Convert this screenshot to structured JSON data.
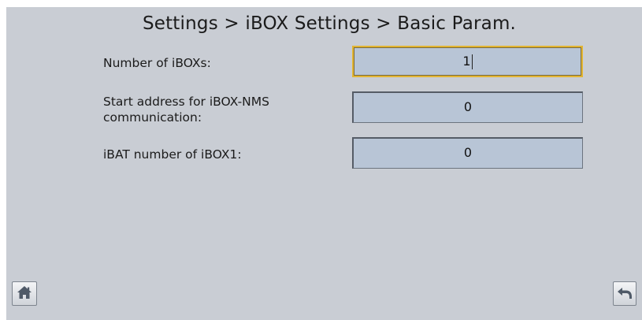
{
  "header": {
    "breadcrumb": "Settings > iBOX Settings > Basic Param."
  },
  "form": {
    "rows": [
      {
        "label": "Number of iBOXs:",
        "value": "1"
      },
      {
        "label": "Start address for iBOX-NMS communication:",
        "value": "0"
      },
      {
        "label": "iBAT number of iBOX1:",
        "value": "0"
      }
    ]
  },
  "footer": {
    "home_icon": "home-icon",
    "back_icon": "back-arrow-icon"
  },
  "colors": {
    "background": "#c9cdd4",
    "field": "#b8c5d6",
    "focus_border": "#e3b531"
  }
}
